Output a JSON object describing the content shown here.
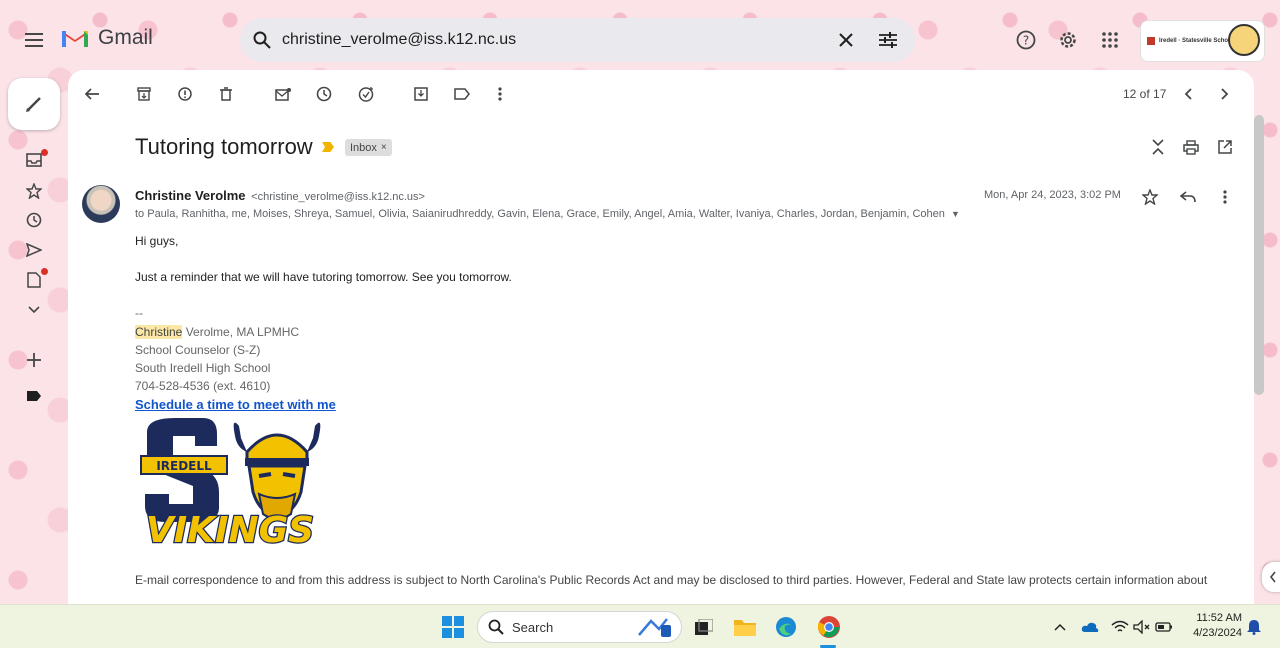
{
  "app": {
    "name": "Gmail"
  },
  "search": {
    "value": "christine_verolme@iss.k12.nc.us"
  },
  "org_badge": {
    "text": "Iredell · Statesville Schools"
  },
  "toolbar": {
    "pager": "12 of 17"
  },
  "email": {
    "subject": "Tutoring tomorrow",
    "label": "Inbox",
    "sender_name": "Christine Verolme",
    "sender_email": "<christine_verolme@iss.k12.nc.us>",
    "recipients": "to Paula, Ranhitha, me, Moises, Shreya, Samuel, Olivia, Saianirudhreddy, Gavin, Elena, Grace, Emily, Angel, Amia, Walter, Ivaniya, Charles, Jordan, Benjamin, Cohen",
    "date": "Mon, Apr 24, 2023, 3:02 PM",
    "greeting": "Hi guys,",
    "body": "Just a reminder that we will have tutoring tomorrow. See you tomorrow.",
    "sig_sep": "--",
    "sig_first": "Christine",
    "sig_name_rest": " Verolme, MA LPMHC",
    "sig_title": "School Counselor (S-Z)",
    "sig_school": "South Iredell High School",
    "sig_phone": "704-528-4536 (ext. 4610)",
    "sig_link": "Schedule a time to meet with me",
    "logo_top": "IREDELL",
    "logo_bottom": "VIKINGS",
    "footer": "E-mail correspondence to and from this address is subject to North Carolina's Public Records Act and may be disclosed to third parties. However, Federal and State law protects certain information about"
  },
  "taskbar": {
    "search_label": "Search",
    "time": "11:52 AM",
    "date": "4/23/2024"
  },
  "colors": {
    "accent_link": "#1155cc",
    "important": "#f2b400",
    "unread_dot": "#d93025"
  }
}
